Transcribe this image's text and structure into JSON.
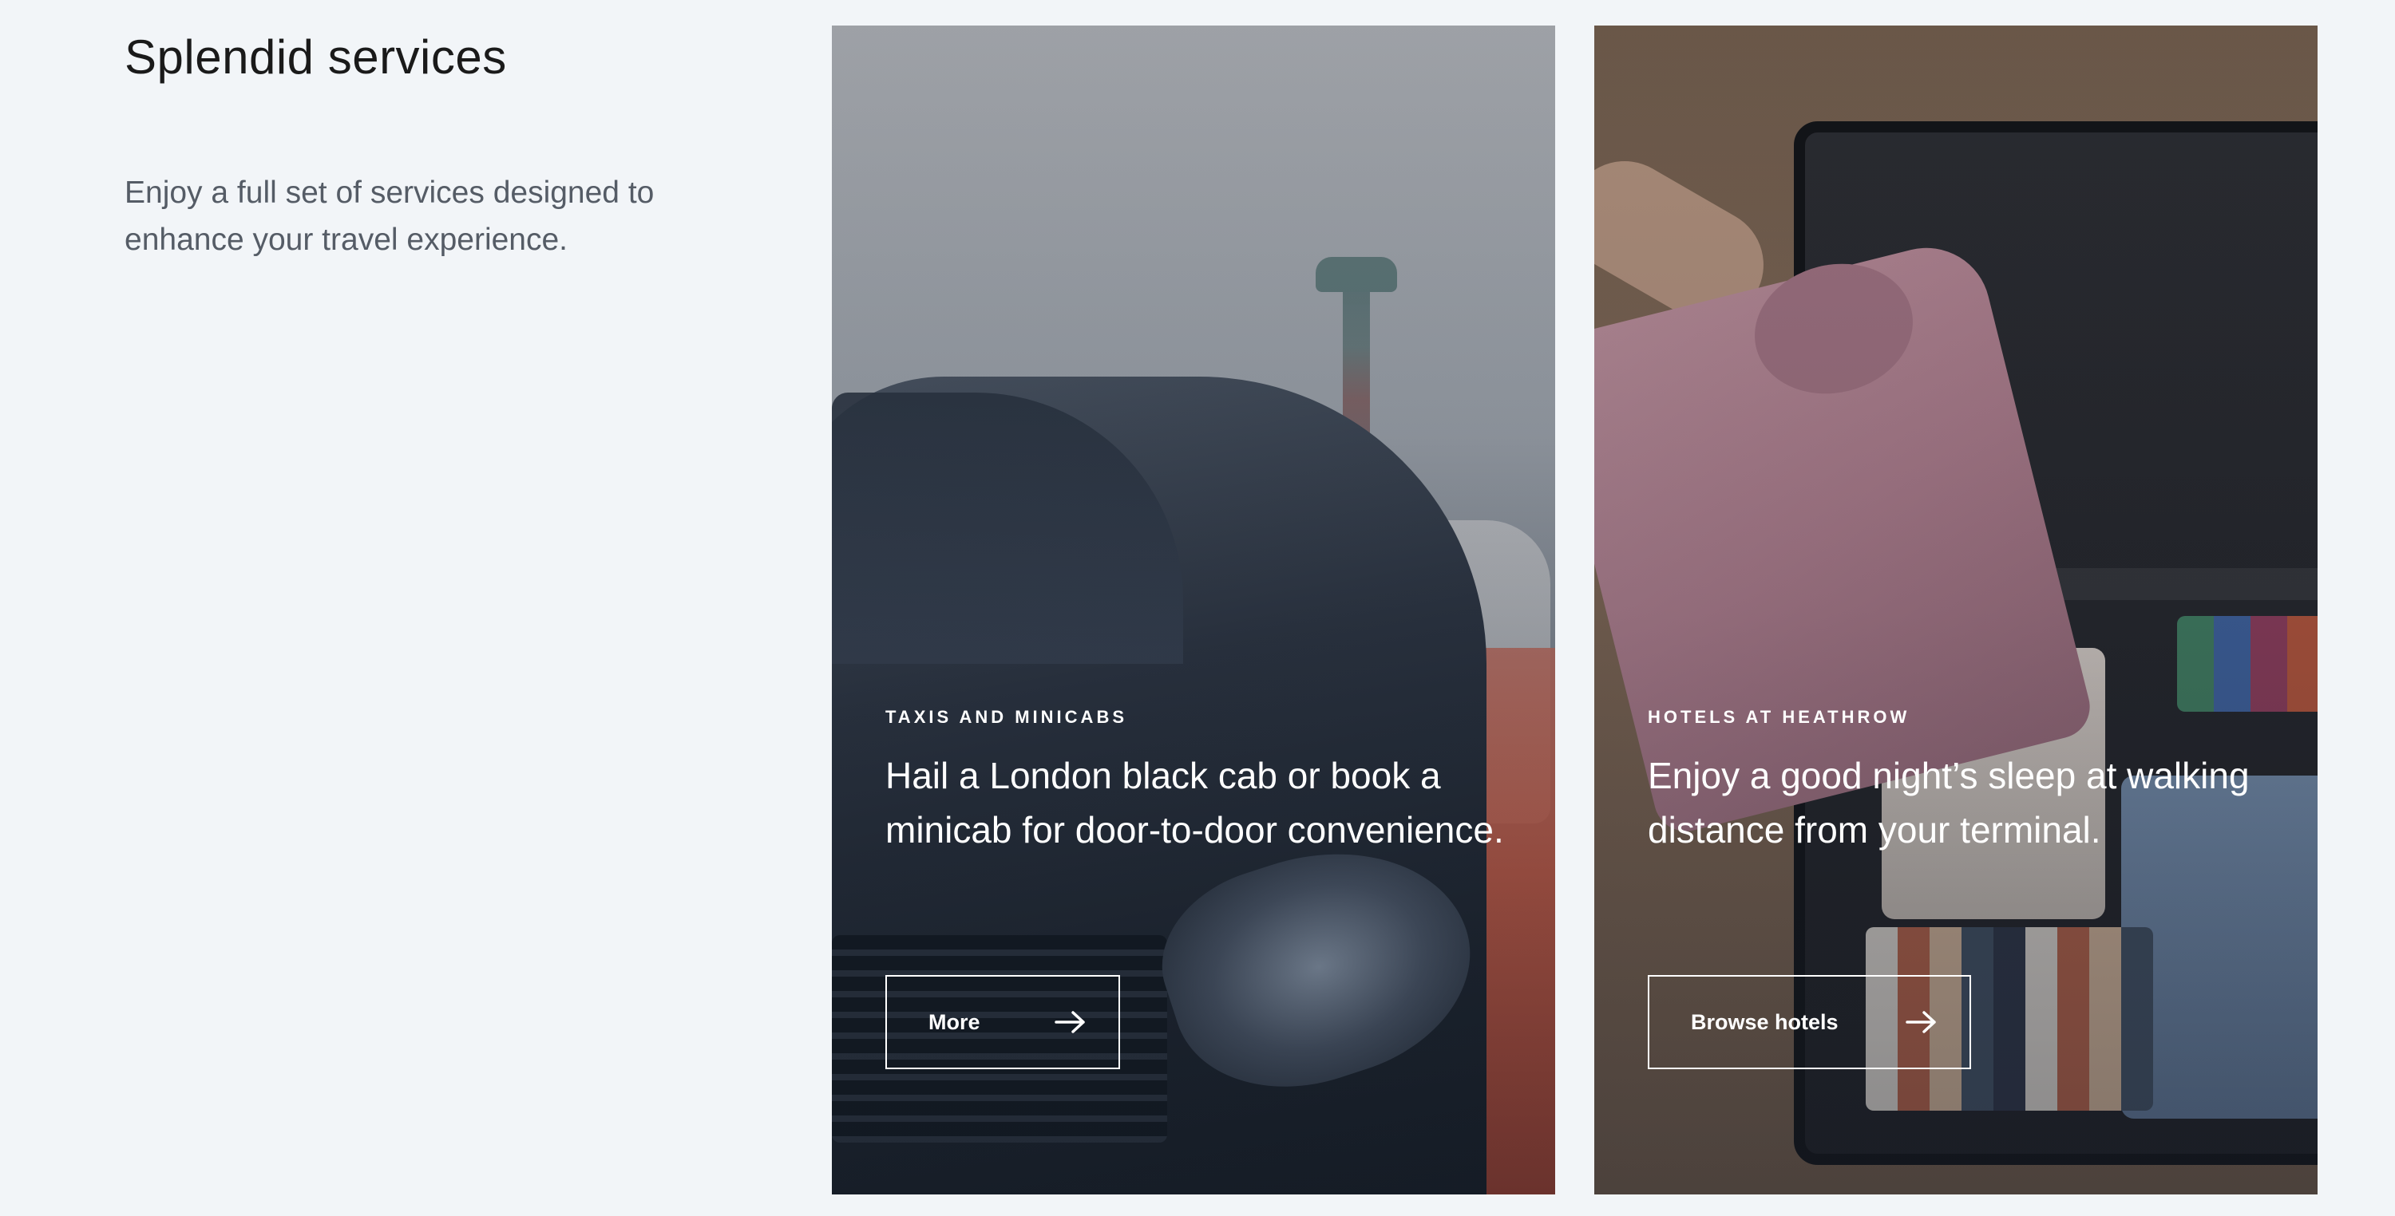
{
  "intro": {
    "title": "Splendid services",
    "description": "Enjoy a full set of services designed to enhance your travel experience."
  },
  "cards": [
    {
      "eyebrow": "TAXIS AND MINICABS",
      "headline": "Hail a London black cab or book a minicab for door-to-door convenience.",
      "button_label": "More",
      "button_icon": "arrow-right-icon",
      "image": "black-car-at-airport-photo"
    },
    {
      "eyebrow": "HOTELS AT HEATHROW",
      "headline": "Enjoy a good night’s sleep at walking distance from your terminal.",
      "button_label": "Browse hotels",
      "button_icon": "arrow-right-icon",
      "image": "packing-suitcase-photo"
    }
  ],
  "colors": {
    "page_background": "#f2f5f8",
    "title_text": "#1a1a1a",
    "body_text": "#555c66",
    "card_text": "#ffffff"
  }
}
